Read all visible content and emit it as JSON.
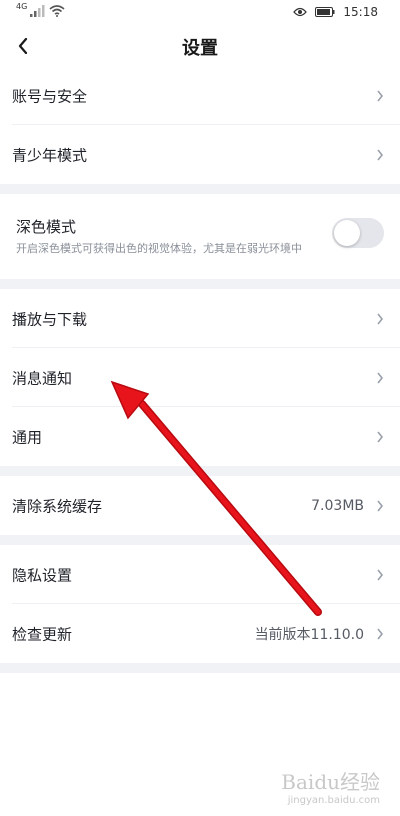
{
  "status_bar": {
    "signal_label": "4G",
    "time": "15:18",
    "icons": [
      "signal-icon",
      "wifi-icon",
      "eye-icon",
      "battery-icon"
    ]
  },
  "nav": {
    "back_icon": "chevron-left-icon",
    "title": "设置"
  },
  "sections": [
    {
      "rows": [
        {
          "label": "账号与安全"
        },
        {
          "label": "青少年模式"
        }
      ]
    },
    {
      "dark_mode": {
        "label": "深色模式",
        "description": "开启深色模式可获得出色的视觉体验，尤其是在弱光环境中",
        "enabled": false
      }
    },
    {
      "rows": [
        {
          "label": "播放与下载"
        },
        {
          "label": "消息通知"
        },
        {
          "label": "通用"
        }
      ]
    },
    {
      "rows": [
        {
          "label": "清除系统缓存",
          "value": "7.03MB"
        }
      ]
    },
    {
      "rows": [
        {
          "label": "隐私设置"
        },
        {
          "label": "检查更新",
          "value": "当前版本11.10.0"
        }
      ]
    }
  ],
  "watermark": {
    "main": "Baidu经验",
    "sub": "jingyan.baidu.com"
  },
  "colors": {
    "section_gap": "#f0f2f6",
    "toggle_off": "#e4e6eb",
    "annotation_arrow": "#e8141b"
  }
}
